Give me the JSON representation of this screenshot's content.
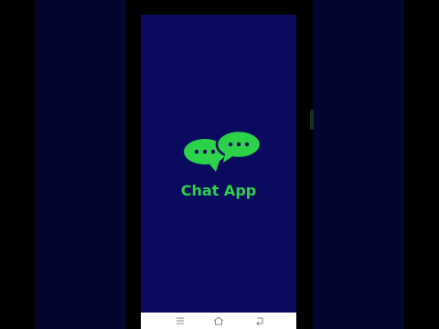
{
  "app": {
    "title": "Chat App"
  },
  "logo": {
    "icon": "chat-bubbles-icon",
    "color": "#2bd24a"
  },
  "colors": {
    "screen_background": "#0a0b5e",
    "side_panels": "#04052e",
    "accent": "#2bd24a",
    "navbar": "#ffffff"
  },
  "navbar": {
    "buttons": [
      {
        "icon": "menu-icon"
      },
      {
        "icon": "home-icon"
      },
      {
        "icon": "back-icon"
      }
    ]
  }
}
